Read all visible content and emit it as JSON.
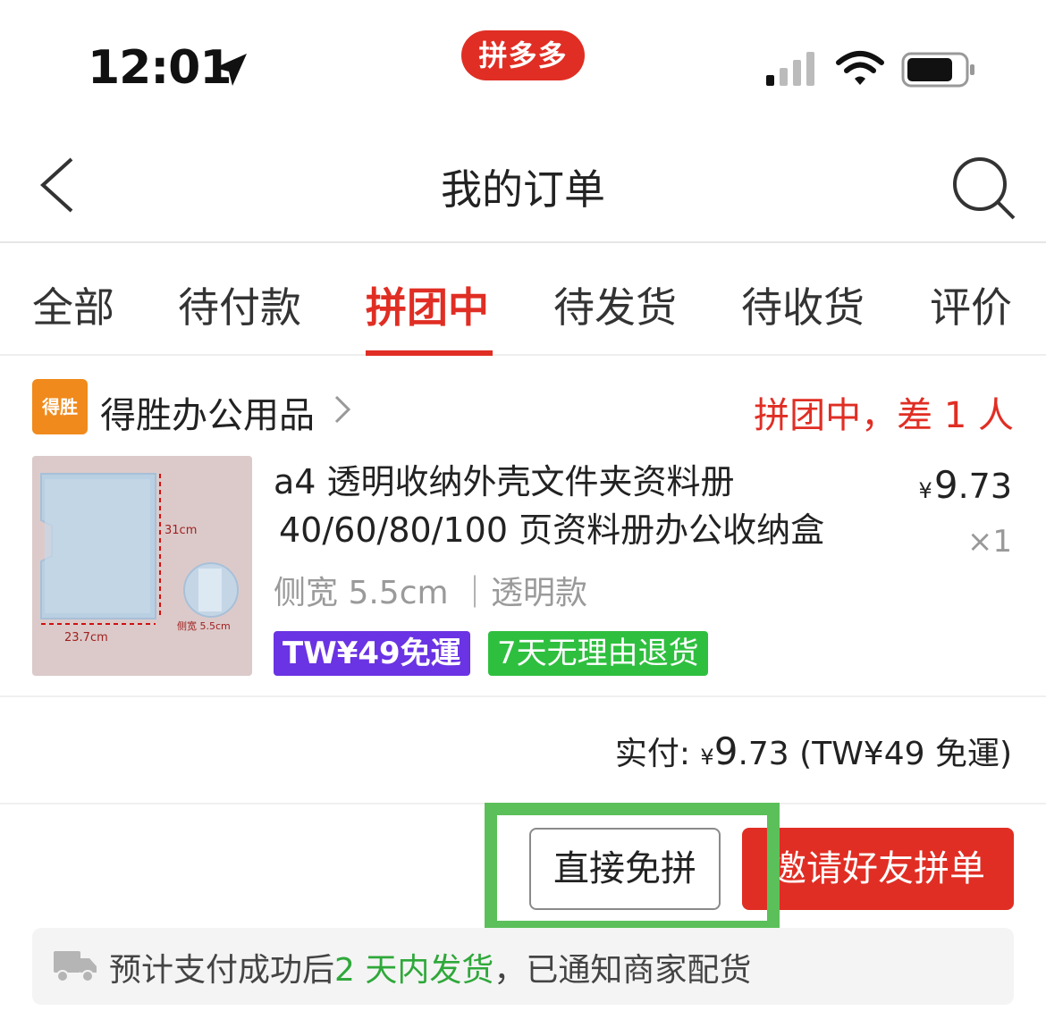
{
  "status_bar": {
    "time": "12:01",
    "app_badge": "拼多多"
  },
  "nav": {
    "title": "我的订单"
  },
  "tabs": [
    {
      "label": "全部",
      "active": false
    },
    {
      "label": "待付款",
      "active": false
    },
    {
      "label": "拼团中",
      "active": true
    },
    {
      "label": "待发货",
      "active": false
    },
    {
      "label": "待收货",
      "active": false
    },
    {
      "label": "评价",
      "active": false
    }
  ],
  "order": {
    "store": {
      "logo_text": "得胜",
      "name": "得胜办公用品"
    },
    "status": "拼团中，差 1 人",
    "product": {
      "title_line1": "a4 透明收纳外壳文件夹资料册",
      "title_line2": "40/60/80/100 页资料册办公收纳盒",
      "variant": "侧宽 5.5cm ｜透明款",
      "price_symbol": "¥",
      "price_int": "9",
      "price_dec": ".73",
      "quantity": "×1",
      "thumb_labels": {
        "height": "31cm",
        "width": "23.7cm",
        "side": "侧宽 5.5cm"
      },
      "tags": {
        "shipping": "TW¥49免運",
        "returns": "7天无理由退货"
      }
    },
    "paid": {
      "label": "实付:",
      "symbol": "¥",
      "amount_int": "9",
      "amount_dec": ".73",
      "note": "(TW¥49 免運)"
    },
    "buttons": {
      "free_group": "直接免拼",
      "invite": "邀请好友拼单"
    },
    "notice": {
      "prefix": "预计支付成功后",
      "highlight": "2 天内发货",
      "suffix": "，已通知商家配货"
    }
  },
  "colors": {
    "brand_red": "#e02e24",
    "highlight_green": "#5cc05a",
    "tag_purple": "#6a33e3",
    "tag_green": "#2fbf3f",
    "store_orange": "#f08a1c"
  }
}
